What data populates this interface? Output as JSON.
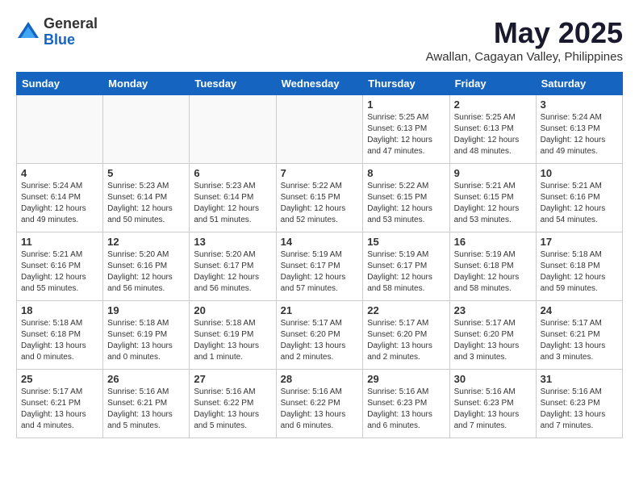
{
  "header": {
    "logo": {
      "general": "General",
      "blue": "Blue"
    },
    "title": "May 2025",
    "subtitle": "Awallan, Cagayan Valley, Philippines"
  },
  "calendar": {
    "days_of_week": [
      "Sunday",
      "Monday",
      "Tuesday",
      "Wednesday",
      "Thursday",
      "Friday",
      "Saturday"
    ],
    "weeks": [
      [
        {
          "day": "",
          "info": ""
        },
        {
          "day": "",
          "info": ""
        },
        {
          "day": "",
          "info": ""
        },
        {
          "day": "",
          "info": ""
        },
        {
          "day": "1",
          "info": "Sunrise: 5:25 AM\nSunset: 6:13 PM\nDaylight: 12 hours\nand 47 minutes."
        },
        {
          "day": "2",
          "info": "Sunrise: 5:25 AM\nSunset: 6:13 PM\nDaylight: 12 hours\nand 48 minutes."
        },
        {
          "day": "3",
          "info": "Sunrise: 5:24 AM\nSunset: 6:13 PM\nDaylight: 12 hours\nand 49 minutes."
        }
      ],
      [
        {
          "day": "4",
          "info": "Sunrise: 5:24 AM\nSunset: 6:14 PM\nDaylight: 12 hours\nand 49 minutes."
        },
        {
          "day": "5",
          "info": "Sunrise: 5:23 AM\nSunset: 6:14 PM\nDaylight: 12 hours\nand 50 minutes."
        },
        {
          "day": "6",
          "info": "Sunrise: 5:23 AM\nSunset: 6:14 PM\nDaylight: 12 hours\nand 51 minutes."
        },
        {
          "day": "7",
          "info": "Sunrise: 5:22 AM\nSunset: 6:15 PM\nDaylight: 12 hours\nand 52 minutes."
        },
        {
          "day": "8",
          "info": "Sunrise: 5:22 AM\nSunset: 6:15 PM\nDaylight: 12 hours\nand 53 minutes."
        },
        {
          "day": "9",
          "info": "Sunrise: 5:21 AM\nSunset: 6:15 PM\nDaylight: 12 hours\nand 53 minutes."
        },
        {
          "day": "10",
          "info": "Sunrise: 5:21 AM\nSunset: 6:16 PM\nDaylight: 12 hours\nand 54 minutes."
        }
      ],
      [
        {
          "day": "11",
          "info": "Sunrise: 5:21 AM\nSunset: 6:16 PM\nDaylight: 12 hours\nand 55 minutes."
        },
        {
          "day": "12",
          "info": "Sunrise: 5:20 AM\nSunset: 6:16 PM\nDaylight: 12 hours\nand 56 minutes."
        },
        {
          "day": "13",
          "info": "Sunrise: 5:20 AM\nSunset: 6:17 PM\nDaylight: 12 hours\nand 56 minutes."
        },
        {
          "day": "14",
          "info": "Sunrise: 5:19 AM\nSunset: 6:17 PM\nDaylight: 12 hours\nand 57 minutes."
        },
        {
          "day": "15",
          "info": "Sunrise: 5:19 AM\nSunset: 6:17 PM\nDaylight: 12 hours\nand 58 minutes."
        },
        {
          "day": "16",
          "info": "Sunrise: 5:19 AM\nSunset: 6:18 PM\nDaylight: 12 hours\nand 58 minutes."
        },
        {
          "day": "17",
          "info": "Sunrise: 5:18 AM\nSunset: 6:18 PM\nDaylight: 12 hours\nand 59 minutes."
        }
      ],
      [
        {
          "day": "18",
          "info": "Sunrise: 5:18 AM\nSunset: 6:18 PM\nDaylight: 13 hours\nand 0 minutes."
        },
        {
          "day": "19",
          "info": "Sunrise: 5:18 AM\nSunset: 6:19 PM\nDaylight: 13 hours\nand 0 minutes."
        },
        {
          "day": "20",
          "info": "Sunrise: 5:18 AM\nSunset: 6:19 PM\nDaylight: 13 hours\nand 1 minute."
        },
        {
          "day": "21",
          "info": "Sunrise: 5:17 AM\nSunset: 6:20 PM\nDaylight: 13 hours\nand 2 minutes."
        },
        {
          "day": "22",
          "info": "Sunrise: 5:17 AM\nSunset: 6:20 PM\nDaylight: 13 hours\nand 2 minutes."
        },
        {
          "day": "23",
          "info": "Sunrise: 5:17 AM\nSunset: 6:20 PM\nDaylight: 13 hours\nand 3 minutes."
        },
        {
          "day": "24",
          "info": "Sunrise: 5:17 AM\nSunset: 6:21 PM\nDaylight: 13 hours\nand 3 minutes."
        }
      ],
      [
        {
          "day": "25",
          "info": "Sunrise: 5:17 AM\nSunset: 6:21 PM\nDaylight: 13 hours\nand 4 minutes."
        },
        {
          "day": "26",
          "info": "Sunrise: 5:16 AM\nSunset: 6:21 PM\nDaylight: 13 hours\nand 5 minutes."
        },
        {
          "day": "27",
          "info": "Sunrise: 5:16 AM\nSunset: 6:22 PM\nDaylight: 13 hours\nand 5 minutes."
        },
        {
          "day": "28",
          "info": "Sunrise: 5:16 AM\nSunset: 6:22 PM\nDaylight: 13 hours\nand 6 minutes."
        },
        {
          "day": "29",
          "info": "Sunrise: 5:16 AM\nSunset: 6:23 PM\nDaylight: 13 hours\nand 6 minutes."
        },
        {
          "day": "30",
          "info": "Sunrise: 5:16 AM\nSunset: 6:23 PM\nDaylight: 13 hours\nand 7 minutes."
        },
        {
          "day": "31",
          "info": "Sunrise: 5:16 AM\nSunset: 6:23 PM\nDaylight: 13 hours\nand 7 minutes."
        }
      ]
    ]
  }
}
